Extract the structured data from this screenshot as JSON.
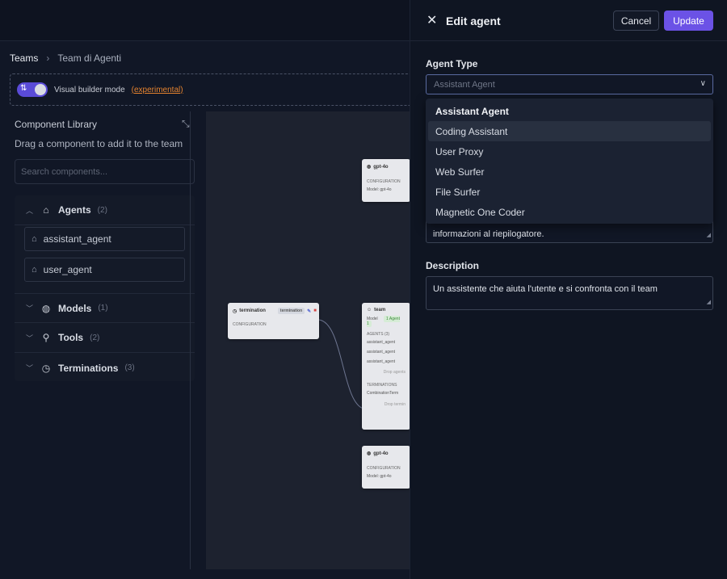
{
  "breadcrumb": {
    "root": "Teams",
    "current": "Team di Agenti"
  },
  "builder": {
    "label": "Visual builder mode",
    "tag": "(experimental)"
  },
  "library": {
    "title": "Component Library",
    "subtitle": "Drag a component to add it to the team",
    "search_placeholder": "Search components...",
    "sections": [
      {
        "label": "Agents",
        "count": "(2)",
        "icon": "robot-icon"
      },
      {
        "label": "Models",
        "count": "(1)",
        "icon": "brain-icon"
      },
      {
        "label": "Tools",
        "count": "(2)",
        "icon": "wrench-icon"
      },
      {
        "label": "Terminations",
        "count": "(3)",
        "icon": "timer-icon"
      }
    ],
    "agents": [
      "assistant_agent",
      "user_agent"
    ]
  },
  "canvas": {
    "node_model_top": {
      "title": "gpt-4o",
      "section": "CONFIGURATION",
      "line": "Model: gpt-4o"
    },
    "node_termination": {
      "title": "termination",
      "badge": "termination",
      "section": "CONFIGURATION"
    },
    "node_team": {
      "title": "team",
      "model_label": "Model",
      "badge": "1 Agent 1",
      "agents_section": "AGENTS (3)",
      "agents": [
        "assistant_agent",
        "assistant_agent",
        "assistant_agent"
      ],
      "drop_agents": "Drop agents",
      "terminations_section": "TERMINATIONS",
      "termination_item": "CombinationTerm",
      "drop_terminations": "Drop termin"
    },
    "node_model_bottom": {
      "title": "gpt-4o",
      "section": "CONFIGURATION",
      "line": "Model: gpt-4o"
    }
  },
  "drawer": {
    "title": "Edit agent",
    "cancel": "Cancel",
    "update": "Update",
    "agent_type_label": "Agent Type",
    "agent_type_placeholder": "Assistant Agent",
    "options": [
      "Assistant Agent",
      "Coding Assistant",
      "User Proxy",
      "Web Surfer",
      "File Surfer",
      "Magnetic One Coder"
    ],
    "system_message_tail": "informazioni al riepilogatore.",
    "description_label": "Description",
    "description_value": "Un assistente che aiuta l'utente e si confronta con il team"
  }
}
